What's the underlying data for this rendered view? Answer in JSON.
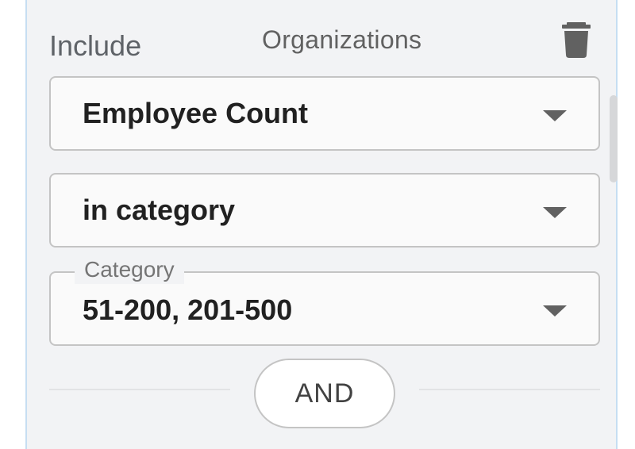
{
  "header": {
    "mode_label": "Include",
    "entity_label": "Organizations",
    "delete_icon": "trash-icon"
  },
  "filter": {
    "field": {
      "value": "Employee Count"
    },
    "operator": {
      "value": "in category"
    },
    "category": {
      "label": "Category",
      "value": "51-200, 201-500"
    }
  },
  "join": {
    "label": "AND"
  },
  "colors": {
    "panel_background": "#f2f3f5",
    "panel_border": "#c6def2",
    "field_background": "#fafafa",
    "field_border": "#c4c4c4",
    "icon": "#616161",
    "text_primary": "#212121",
    "text_secondary": "#5f6368"
  }
}
